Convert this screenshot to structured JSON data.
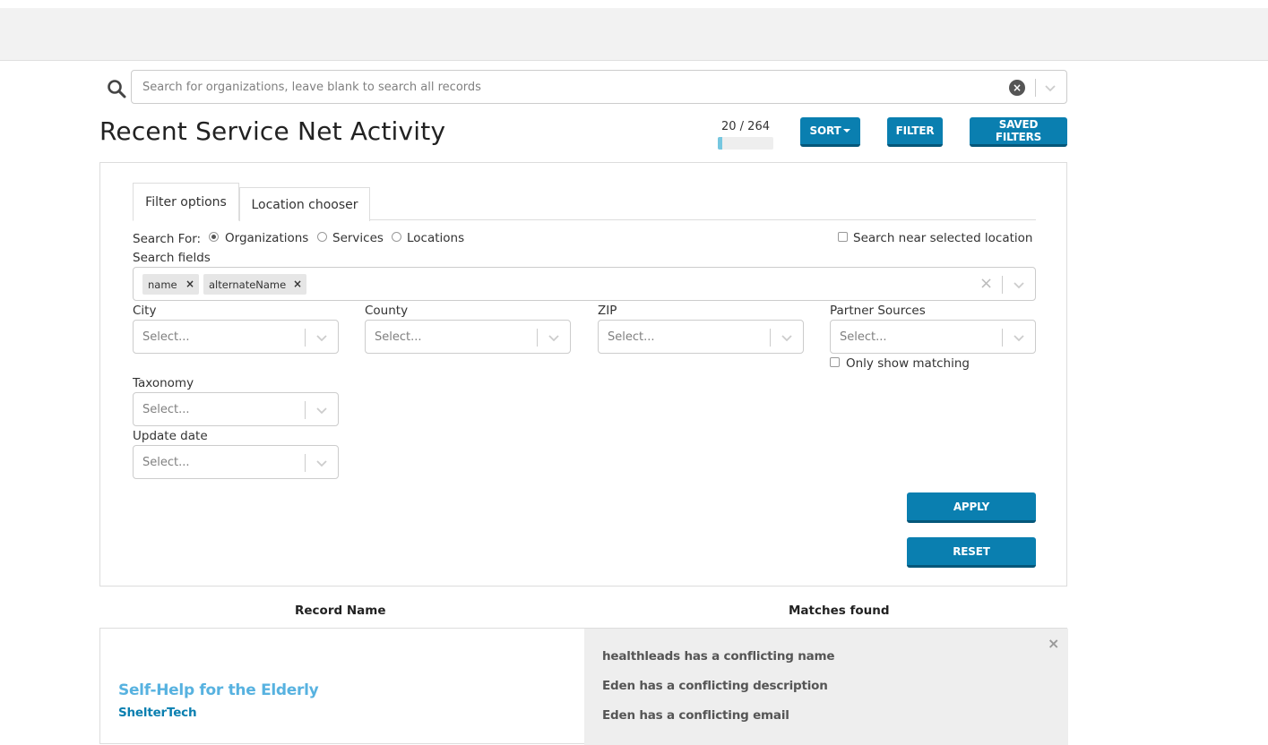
{
  "search": {
    "placeholder": "Search for organizations, leave blank to search all records",
    "clear_glyph": "×"
  },
  "page_title": "Recent Service Net Activity",
  "results": {
    "count_label": "20 / 264",
    "progress_fraction": 0.076
  },
  "toolbar": {
    "sort_label": "SORT",
    "filter_label": "FILTER",
    "saved_filters_label": "SAVED FILTERS"
  },
  "filter_panel": {
    "tabs": [
      {
        "label": "Filter options",
        "active": true
      },
      {
        "label": "Location chooser",
        "active": false
      }
    ],
    "search_for_label": "Search For:",
    "search_for_options": [
      {
        "label": "Organizations",
        "checked": true
      },
      {
        "label": "Services",
        "checked": false
      },
      {
        "label": "Locations",
        "checked": false
      }
    ],
    "search_near_label": "Search near selected location",
    "search_fields_label": "Search fields",
    "search_fields_chips": [
      {
        "label": "name",
        "remove": "×"
      },
      {
        "label": "alternateName",
        "remove": "×"
      }
    ],
    "clear_all_glyph": "×",
    "city": {
      "label": "City",
      "placeholder": "Select..."
    },
    "county": {
      "label": "County",
      "placeholder": "Select..."
    },
    "zip": {
      "label": "ZIP",
      "placeholder": "Select..."
    },
    "partner_sources": {
      "label": "Partner Sources",
      "placeholder": "Select..."
    },
    "only_show_matching_label": "Only show matching",
    "taxonomy": {
      "label": "Taxonomy",
      "placeholder": "Select..."
    },
    "update_date": {
      "label": "Update date",
      "placeholder": "Select..."
    },
    "apply_label": "APPLY",
    "reset_label": "RESET"
  },
  "records": {
    "headers": {
      "record_name": "Record Name",
      "matches_found": "Matches found"
    },
    "items": [
      {
        "name": "Self-Help for the Elderly",
        "source": "ShelterTech",
        "close_glyph": "×",
        "matches": [
          "healthleads has a conflicting name",
          "Eden has a conflicting description",
          "Eden has a conflicting email"
        ]
      }
    ]
  },
  "colors": {
    "primary_button": "#0a7fb0",
    "link_light_blue": "#57b2e0",
    "progress_fill": "#76c7e0"
  }
}
